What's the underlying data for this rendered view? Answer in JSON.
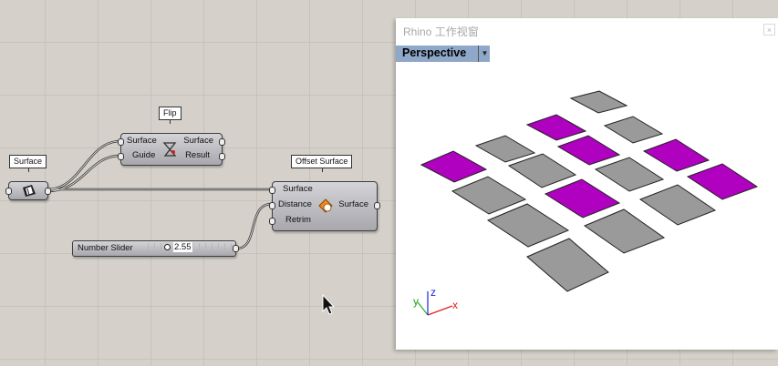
{
  "canvas": {
    "surface_param": {
      "tag": "Surface"
    },
    "flip": {
      "tag": "Flip",
      "inputs": [
        "Surface",
        "Guide"
      ],
      "outputs": [
        "Surface",
        "Result"
      ]
    },
    "offset_surface": {
      "tag": "Offset Surface",
      "inputs": [
        "Surface",
        "Distance",
        "Retrim"
      ],
      "outputs": [
        "Surface"
      ]
    },
    "number_slider": {
      "label": "Number Slider",
      "value": "2.55"
    }
  },
  "viewport": {
    "title": "Rhino 工作视窗",
    "view_name": "Perspective",
    "close_label": "×",
    "axes": {
      "x": "x",
      "y": "y",
      "z": "z"
    },
    "colors": {
      "gray": "#9a9a9a",
      "magenta": "#b000c0",
      "header": "#8fa7c8"
    }
  }
}
